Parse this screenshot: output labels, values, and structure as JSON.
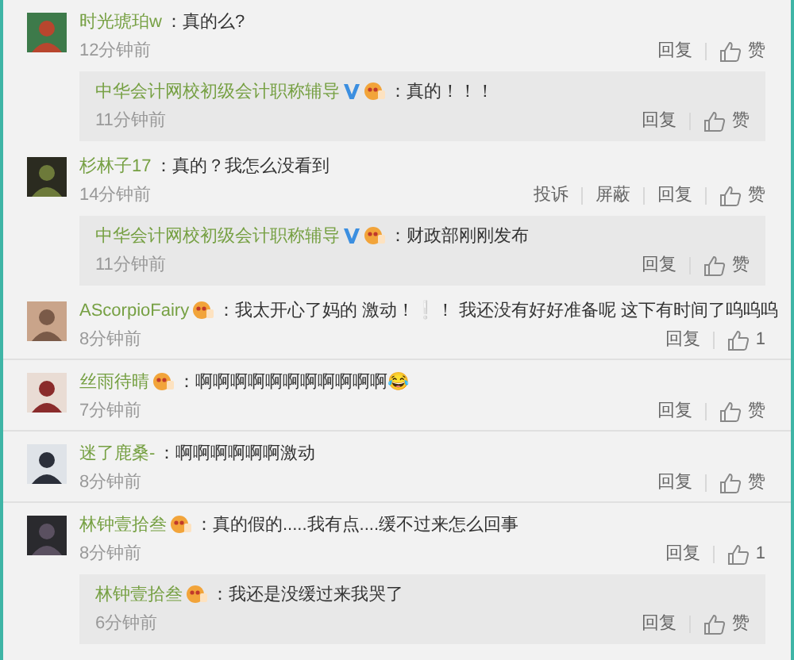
{
  "comments": [
    {
      "user": "时光琥珀w",
      "verified": false,
      "member": false,
      "text": "：真的么?",
      "time": "12分钟前",
      "actions": [
        "回复"
      ],
      "like": "赞",
      "replies": [
        {
          "user": "中华会计网校初级会计职称辅导",
          "verified": true,
          "member": true,
          "text": "：真的！！！",
          "time": "11分钟前",
          "actions": [
            "回复"
          ],
          "like": "赞"
        }
      ]
    },
    {
      "user": "杉林子17",
      "verified": false,
      "member": false,
      "text": "：真的？我怎么没看到",
      "time": "14分钟前",
      "actions": [
        "投诉",
        "屏蔽",
        "回复"
      ],
      "like": "赞",
      "replies": [
        {
          "user": "中华会计网校初级会计职称辅导",
          "verified": true,
          "member": true,
          "text": "：财政部刚刚发布",
          "time": "11分钟前",
          "actions": [
            "回复"
          ],
          "like": "赞"
        }
      ]
    },
    {
      "user": "AScorpioFairy",
      "verified": false,
      "member": true,
      "text": "：我太开心了妈的 激动！❕！ 我还没有好好准备呢 这下有时间了呜呜呜",
      "time": "8分钟前",
      "actions": [
        "回复"
      ],
      "like": "1"
    },
    {
      "user": "丝雨待晴",
      "verified": false,
      "member": true,
      "text": "：啊啊啊啊啊啊啊啊啊啊啊😂",
      "time": "7分钟前",
      "actions": [
        "回复"
      ],
      "like": "赞"
    },
    {
      "user": "迷了鹿桑-",
      "verified": false,
      "member": false,
      "text": "：啊啊啊啊啊啊激动",
      "time": "8分钟前",
      "actions": [
        "回复"
      ],
      "like": "赞"
    },
    {
      "user": "林钟壹拾叁",
      "verified": false,
      "member": true,
      "text": "：真的假的.....我有点....缓不过来怎么回事",
      "time": "8分钟前",
      "actions": [
        "回复"
      ],
      "like": "1",
      "replies": [
        {
          "user": "林钟壹拾叁",
          "verified": false,
          "member": true,
          "text": "：我还是没缓过来我哭了",
          "time": "6分钟前",
          "actions": [
            "回复"
          ],
          "like": "赞"
        }
      ]
    }
  ]
}
